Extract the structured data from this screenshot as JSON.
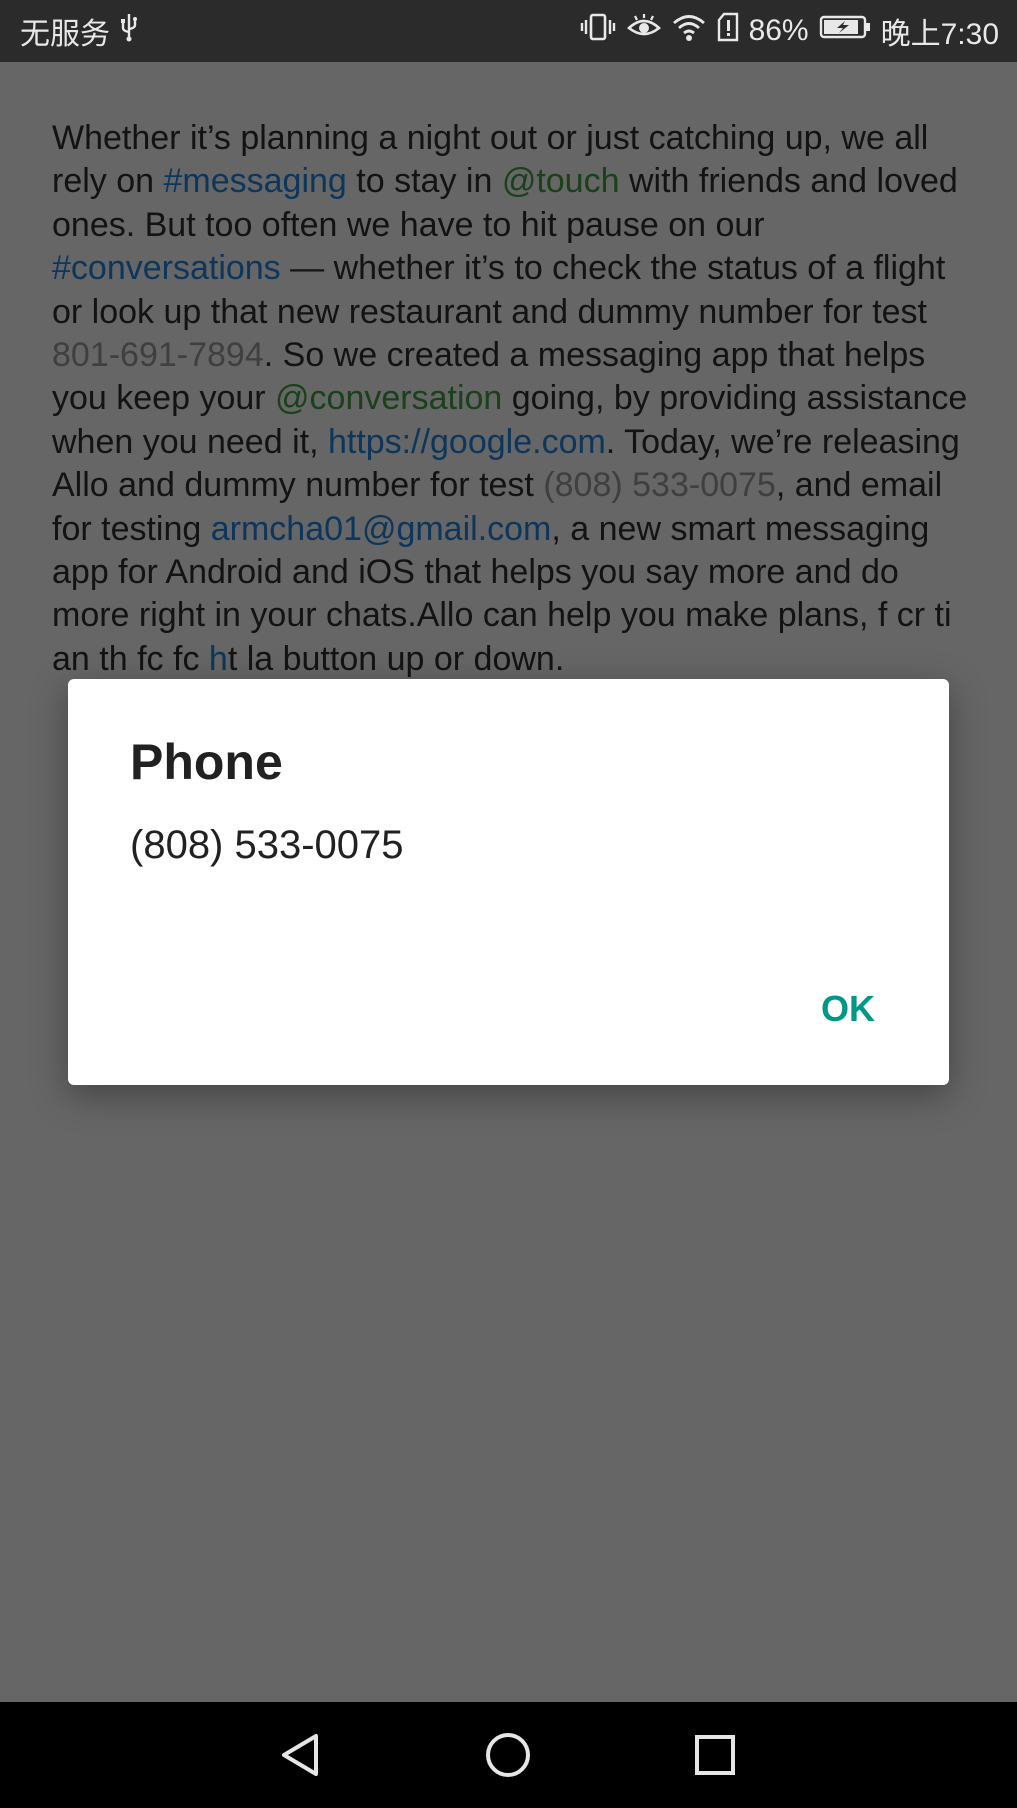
{
  "status_bar": {
    "carrier": "无服务",
    "battery": "86%",
    "time": "晚上7:30",
    "icons": [
      "usb-icon",
      "vibrate-icon",
      "eye-icon",
      "wifi-icon",
      "sim-alert-icon",
      "battery-charging-icon"
    ]
  },
  "article": {
    "segments": [
      {
        "type": "text",
        "text": "Whether it’s planning a night out or just catching up, we all rely on "
      },
      {
        "type": "hashtag",
        "text": "#messaging"
      },
      {
        "type": "text",
        "text": " to stay in "
      },
      {
        "type": "mention",
        "text": "@touch"
      },
      {
        "type": "text",
        "text": " with friends and loved ones. But too often we have to hit pause on our "
      },
      {
        "type": "hashtag",
        "text": "#conversations"
      },
      {
        "type": "text",
        "text": " — whether it’s to check the status of a flight or look up that new restaurant and dummy number for test "
      },
      {
        "type": "phone",
        "text": "801-691-7894"
      },
      {
        "type": "text",
        "text": ". So we created a messaging app that helps you keep your "
      },
      {
        "type": "mention",
        "text": "@conversation"
      },
      {
        "type": "text",
        "text": " going, by providing assistance when you need it, "
      },
      {
        "type": "link",
        "text": "https://google.com"
      },
      {
        "type": "text",
        "text": ". Today, we’re releasing Allo and dummy number for test "
      },
      {
        "type": "phone",
        "text": "(808) 533-0075"
      },
      {
        "type": "text",
        "text": ", and email for testing "
      },
      {
        "type": "link",
        "text": "armcha01@gmail.com"
      },
      {
        "type": "text",
        "text": ", a new smart messaging app for Android and iOS that helps you say more and do more right in your chats.Allo can help you make plans, "
      },
      {
        "type": "text",
        "text": "f"
      },
      {
        "type": "text",
        "text": " c"
      },
      {
        "type": "text",
        "text": "r ti"
      },
      {
        "type": "text",
        "text": " a"
      },
      {
        "type": "text",
        "text": "n th"
      },
      {
        "type": "text",
        "text": " fc"
      },
      {
        "type": "text",
        "text": " fc"
      },
      {
        "type": "link",
        "text": " h"
      },
      {
        "type": "text",
        "text": "t la"
      },
      {
        "type": "text",
        "text": " button up or down."
      }
    ]
  },
  "dialog": {
    "title": "Phone",
    "message": "(808) 533-0075",
    "ok_label": "OK"
  },
  "colors": {
    "accent": "#009688",
    "hashtag_link": "#1e88e5",
    "mention": "#43a047",
    "phone": "#9e9e9e"
  }
}
